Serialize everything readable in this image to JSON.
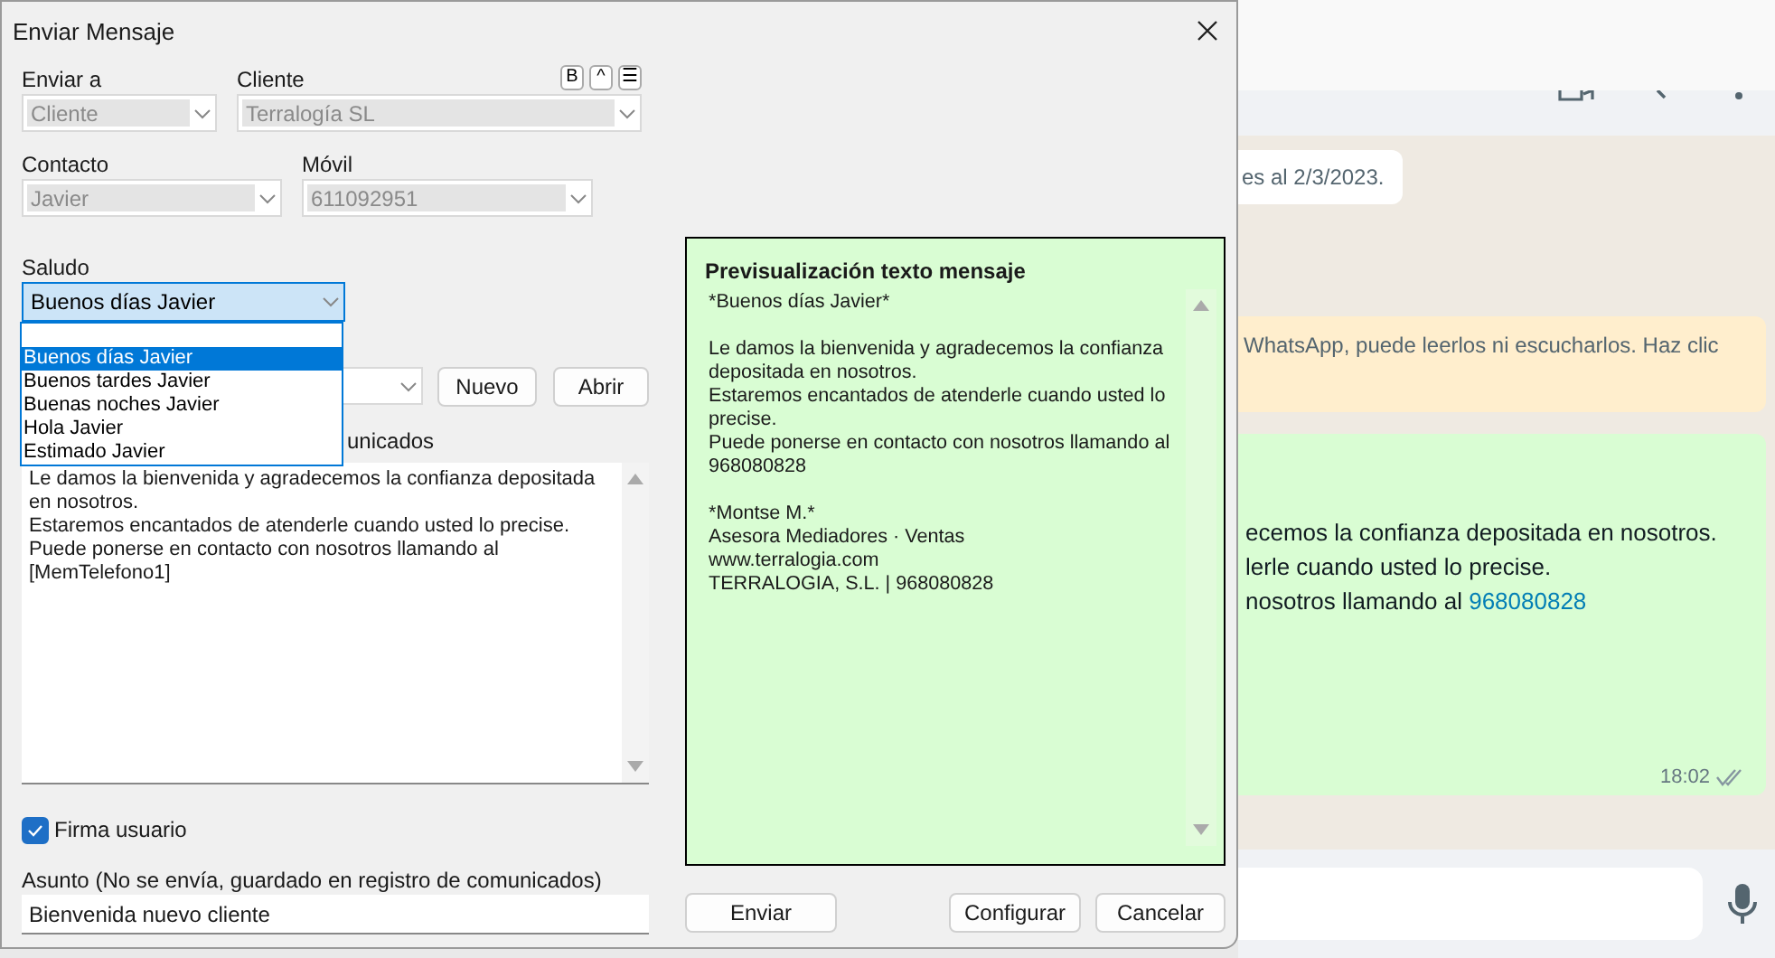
{
  "window": {
    "title": "Enviar Mensaje"
  },
  "format_buttons": [
    {
      "label": "B"
    },
    {
      "label": "^"
    },
    {
      "label": "☰"
    }
  ],
  "fields": [
    {
      "label": "Enviar a",
      "value": "Cliente",
      "disabled": true
    },
    {
      "label": "Cliente",
      "value": "Terralogía SL",
      "disabled": true
    },
    {
      "label": "Contacto",
      "value": "Javier",
      "disabled": true
    },
    {
      "label": "Móvil",
      "value": "611092951",
      "disabled": true
    }
  ],
  "saludo": {
    "label": "Saludo",
    "value": "Buenos días Javier",
    "expanded": true,
    "options": [
      {
        "label": "Buenos días Javier",
        "selected": true
      },
      {
        "label": "Buenos tardes Javier",
        "selected": false
      },
      {
        "label": "Buenas noches Javier",
        "selected": false
      },
      {
        "label": "Hola Javier",
        "selected": false
      },
      {
        "label": "Estimado Javier",
        "selected": false
      }
    ]
  },
  "template_buttons": [
    "Nuevo",
    "Abrir"
  ],
  "message": {
    "label": "unicados",
    "lines": [
      "Le damos la bienvenida y agradecemos la confianza depositada",
      "en nosotros.",
      "Estaremos encantados de atenderle cuando usted lo precise.",
      "Puede ponerse en contacto con nosotros llamando al",
      "[MemTelefono1]"
    ]
  },
  "signature": {
    "label": "Firma usuario",
    "checked": true
  },
  "subject": {
    "label": "Asunto (No se envía, guardado en registro de comunicados)",
    "value": "Bienvenida nuevo cliente"
  },
  "preview": {
    "title": "Previsualización texto mensaje",
    "paragraphs": [
      [
        "*Buenos días Javier*"
      ],
      [
        "Le damos la bienvenida y agradecemos la confianza",
        "depositada en nosotros.",
        "Estaremos encantados de atenderle cuando usted lo",
        "precise.",
        "Puede ponerse en contacto con nosotros llamando al",
        "968080828"
      ],
      [
        "*Montse M.*",
        "Asesora Mediadores · Ventas",
        "www.terralogia.com",
        "TERRALOGIA, S.L.  | 968080828"
      ]
    ]
  },
  "buttons": [
    "Enviar",
    "Configurar",
    "Cancelar"
  ],
  "chat": {
    "date_notice": "es al 2/3/2023.",
    "security_notice": "WhatsApp, puede leerlos ni escucharlos. Haz clic",
    "message": {
      "lines": [
        "ecemos la confianza depositada en nosotros.",
        "lerle cuando usted lo precise."
      ],
      "last_line": " nosotros llamando al",
      "link": "968080828",
      "time": "18:02",
      "read": false
    }
  }
}
